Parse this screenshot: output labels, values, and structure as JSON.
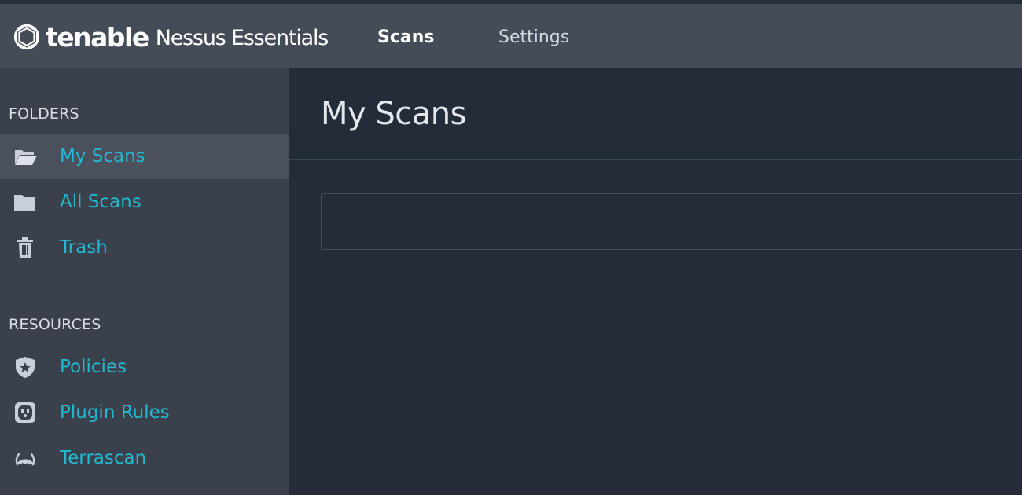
{
  "app": {
    "brand": "tenable",
    "product": "Nessus Essentials"
  },
  "nav": {
    "tabs": [
      {
        "label": "Scans",
        "active": true
      },
      {
        "label": "Settings",
        "active": false
      }
    ]
  },
  "sidebar": {
    "folders_header": "FOLDERS",
    "folders": [
      {
        "label": "My Scans",
        "icon": "folder-open-icon",
        "active": true
      },
      {
        "label": "All Scans",
        "icon": "folder-icon",
        "active": false
      },
      {
        "label": "Trash",
        "icon": "trash-icon",
        "active": false
      }
    ],
    "resources_header": "RESOURCES",
    "resources": [
      {
        "label": "Policies",
        "icon": "shield-star-icon"
      },
      {
        "label": "Plugin Rules",
        "icon": "plug-icon"
      },
      {
        "label": "Terrascan",
        "icon": "radar-icon"
      }
    ]
  },
  "main": {
    "title": "My Scans"
  },
  "colors": {
    "accent": "#22b8d1",
    "topbar": "#444c58",
    "sidebar": "#3a414c",
    "main_bg": "#242c3a"
  }
}
